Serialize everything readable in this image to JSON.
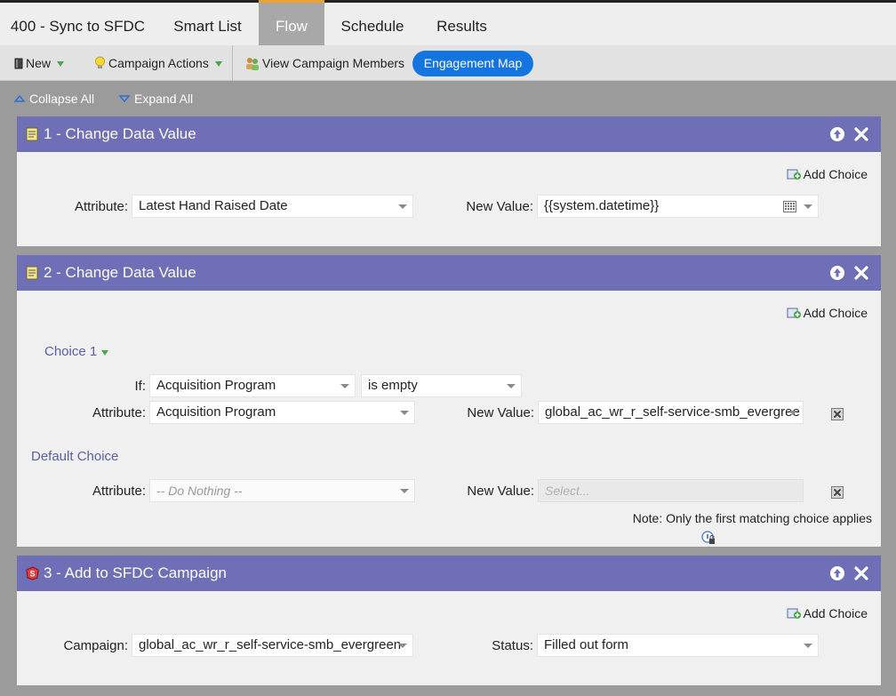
{
  "tabs": [
    {
      "label": "400 - Sync to SFDC"
    },
    {
      "label": "Smart List"
    },
    {
      "label": "Flow"
    },
    {
      "label": "Schedule"
    },
    {
      "label": "Results"
    }
  ],
  "toolbar": {
    "new_label": "New",
    "campaign_actions_label": "Campaign Actions",
    "view_members_label": "View Campaign Members",
    "engagement_map_label": "Engagement Map"
  },
  "collapse": {
    "collapse_all": "Collapse All",
    "expand_all": "Expand All"
  },
  "steps": [
    {
      "title": "1 - Change Data Value",
      "add_choice": "Add Choice",
      "attribute_label": "Attribute:",
      "attribute_value": "Latest Hand Raised Date",
      "new_value_label": "New Value:",
      "new_value": "{{system.datetime}}"
    },
    {
      "title": "2 - Change Data Value",
      "add_choice": "Add Choice",
      "choice_label": "Choice 1",
      "if_label": "If:",
      "if_field": "Acquisition Program",
      "if_operator": "is empty",
      "attribute_label": "Attribute:",
      "attribute_value": "Acquisition Program",
      "new_value_label": "New Value:",
      "new_value": "global_ac_wr_r_self-service-smb_evergree",
      "default_choice_label": "Default Choice",
      "default_attribute_label": "Attribute:",
      "default_attribute_value": "-- Do Nothing --",
      "default_new_value_label": "New Value:",
      "default_new_value_placeholder": "Select...",
      "note": "Note: Only the first matching choice applies"
    },
    {
      "title": "3 - Add to SFDC Campaign",
      "add_choice": "Add Choice",
      "campaign_label": "Campaign:",
      "campaign_value": "global_ac_wr_r_self-service-smb_evergreen",
      "status_label": "Status:",
      "status_value": "Filled out form"
    }
  ],
  "colors": {
    "panel_header": "#6e6fb6",
    "pill": "#1475e0",
    "tab_accent": "#f0a030"
  }
}
